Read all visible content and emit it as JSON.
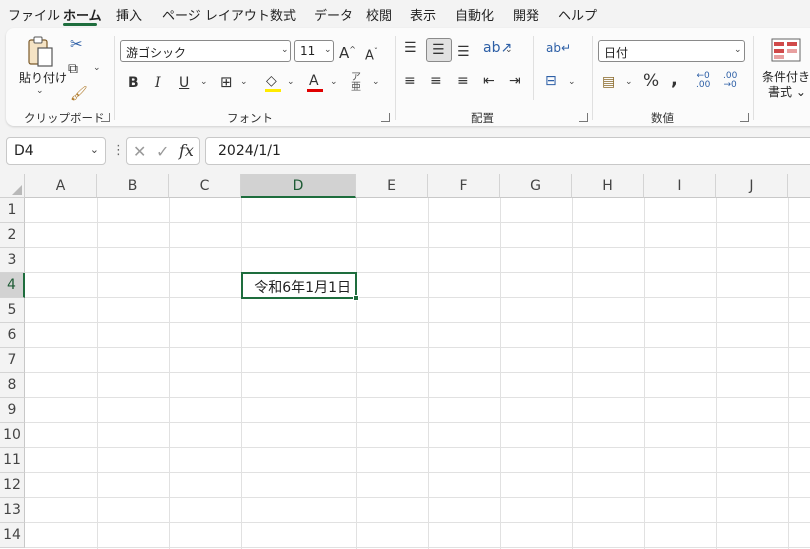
{
  "menu": {
    "tabs": [
      "ファイル",
      "ホーム",
      "挿入",
      "ページ レイアウト",
      "数式",
      "データ",
      "校閲",
      "表示",
      "自動化",
      "開発",
      "ヘルプ"
    ],
    "active_tab": "ホーム"
  },
  "ribbon": {
    "clipboard": {
      "paste_label": "貼り付け",
      "group_label": "クリップボード"
    },
    "font": {
      "font_name": "游ゴシック",
      "font_size": "11",
      "group_label": "フォント",
      "font_color": "#e00000",
      "fill_color": "#ffeb00"
    },
    "alignment": {
      "group_label": "配置"
    },
    "number": {
      "format": "日付",
      "group_label": "数値"
    },
    "styles": {
      "conditional_label": "条件付き",
      "conditional_label2": "書式 ⌄"
    }
  },
  "formula_bar": {
    "name_box": "D4",
    "fx_label": "fx",
    "formula": "2024/1/1"
  },
  "sheet": {
    "columns": [
      "A",
      "B",
      "C",
      "D",
      "E",
      "F",
      "G",
      "H",
      "I",
      "J"
    ],
    "rows": [
      "1",
      "2",
      "3",
      "4",
      "5",
      "6",
      "7",
      "8",
      "9",
      "10",
      "11",
      "12",
      "13",
      "14"
    ],
    "selected_column": "D",
    "selected_row": "4",
    "active_cell_value": "令和6年1月1日"
  },
  "colors": {
    "accent": "#1e6d3d",
    "grid": "#e1e1e1",
    "header_bg": "#f3f3f3"
  }
}
